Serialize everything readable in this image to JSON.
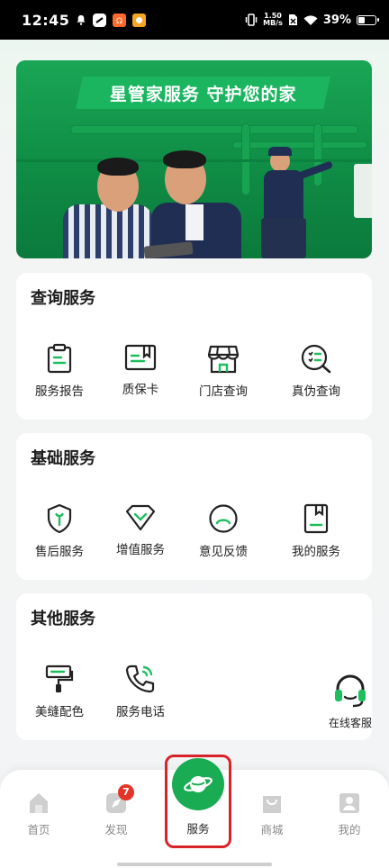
{
  "status_bar": {
    "time": "12:45",
    "speed": "1.50\nMB/s",
    "speed_top": "1.50",
    "speed_bottom": "MB/s",
    "battery": "39%",
    "battery_level": 0.39
  },
  "banner": {
    "title": "星管家服务  守护您的家",
    "colors": {
      "primary": "#1bb560",
      "dark": "#0f8c45"
    }
  },
  "sections": [
    {
      "title": "查询服务",
      "items": [
        {
          "label": "服务报告",
          "icon": "clipboard-report-icon"
        },
        {
          "label": "质保卡",
          "icon": "warranty-card-icon"
        },
        {
          "label": "门店查询",
          "icon": "store-icon"
        },
        {
          "label": "真伪查询",
          "icon": "verify-search-icon"
        }
      ]
    },
    {
      "title": "基础服务",
      "items": [
        {
          "label": "售后服务",
          "icon": "shield-wrench-icon"
        },
        {
          "label": "增值服务",
          "icon": "diamond-icon"
        },
        {
          "label": "意见反馈",
          "icon": "feedback-face-icon"
        },
        {
          "label": "我的服务",
          "icon": "bookmark-doc-icon"
        }
      ]
    },
    {
      "title": "其他服务",
      "items": [
        {
          "label": "美缝配色",
          "icon": "paint-roller-icon"
        },
        {
          "label": "服务电话",
          "icon": "phone-icon"
        }
      ]
    }
  ],
  "float_service": {
    "label": "在线客服",
    "icon": "headset-icon"
  },
  "bottom_nav": {
    "items": [
      {
        "label": "首页",
        "icon": "home-icon"
      },
      {
        "label": "发现",
        "icon": "discover-icon",
        "badge": "7"
      },
      {
        "label": "服务",
        "icon": "planet-icon",
        "active": true
      },
      {
        "label": "商城",
        "icon": "shopping-bag-icon"
      },
      {
        "label": "我的",
        "icon": "profile-icon"
      }
    ]
  },
  "colors": {
    "accent": "#19ac52",
    "icon_accent": "#1dbf5c",
    "badge": "#e5332a",
    "highlight": "#d9232b"
  }
}
